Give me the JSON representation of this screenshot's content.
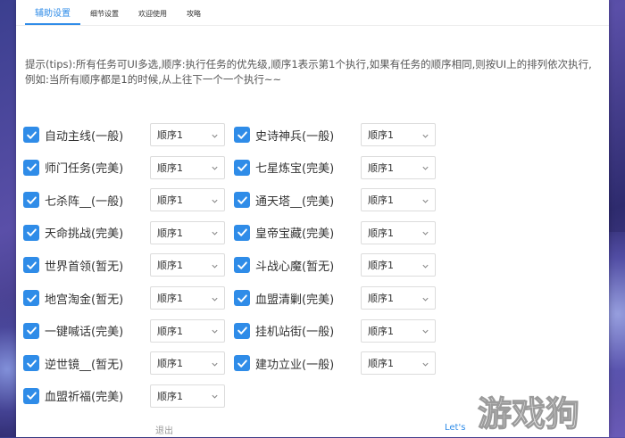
{
  "tabs": [
    {
      "label": "辅助设置",
      "active": true
    },
    {
      "label": "细节设置",
      "active": false
    },
    {
      "label": "欢迎使用",
      "active": false
    },
    {
      "label": "攻略",
      "active": false
    }
  ],
  "tips": "提示(tips):所有任务可UI多选,顺序:执行任务的优先级,顺序1表示第1个执行,如果有任务的顺序相同,则按UI上的排列依次执行,例如:当所有顺序都是1的时候,从上往下一个一个执行~~",
  "tasks_left": [
    {
      "label": "自动主线(一般)",
      "checked": true,
      "order": "顺序1"
    },
    {
      "label": "师门任务(完美)",
      "checked": true,
      "order": "顺序1"
    },
    {
      "label": "七杀阵__(一般)",
      "checked": true,
      "order": "顺序1"
    },
    {
      "label": "天命挑战(完美)",
      "checked": true,
      "order": "顺序1"
    },
    {
      "label": "世界首领(暂无)",
      "checked": true,
      "order": "顺序1"
    },
    {
      "label": "地宫淘金(暂无)",
      "checked": true,
      "order": "顺序1"
    },
    {
      "label": "一键喊话(完美)",
      "checked": true,
      "order": "顺序1"
    },
    {
      "label": "逆世镜__(暂无)",
      "checked": true,
      "order": "顺序1"
    },
    {
      "label": "血盟祈福(完美)",
      "checked": true,
      "order": "顺序1"
    }
  ],
  "tasks_right": [
    {
      "label": "史诗神兵(一般)",
      "checked": true,
      "order": "顺序1"
    },
    {
      "label": "七星炼宝(完美)",
      "checked": true,
      "order": "顺序1"
    },
    {
      "label": "通天塔__(完美)",
      "checked": true,
      "order": "顺序1"
    },
    {
      "label": "皇帝宝藏(完美)",
      "checked": true,
      "order": "顺序1"
    },
    {
      "label": "斗战心魔(暂无)",
      "checked": true,
      "order": "顺序1"
    },
    {
      "label": "血盟清剿(完美)",
      "checked": true,
      "order": "顺序1"
    },
    {
      "label": "挂机站街(一般)",
      "checked": true,
      "order": "顺序1"
    },
    {
      "label": "建功立业(一般)",
      "checked": true,
      "order": "顺序1"
    }
  ],
  "footer": {
    "exit_label": "退出",
    "start_label": "Let's"
  },
  "watermark_text": "游戏狗",
  "colors": {
    "accent": "#2f8ce8"
  }
}
